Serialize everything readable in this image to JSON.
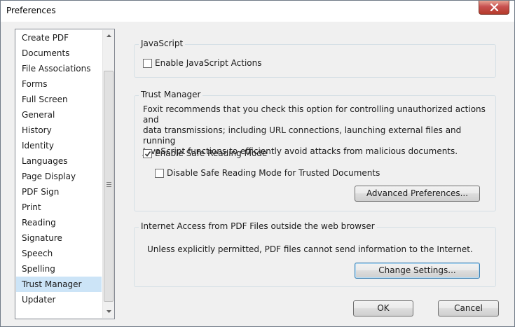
{
  "window": {
    "title": "Preferences"
  },
  "sidebar": {
    "items": [
      {
        "label": "Create PDF"
      },
      {
        "label": "Documents"
      },
      {
        "label": "File Associations"
      },
      {
        "label": "Forms"
      },
      {
        "label": "Full Screen"
      },
      {
        "label": "General"
      },
      {
        "label": "History"
      },
      {
        "label": "Identity"
      },
      {
        "label": "Languages"
      },
      {
        "label": "Page Display"
      },
      {
        "label": "PDF Sign"
      },
      {
        "label": "Print"
      },
      {
        "label": "Reading"
      },
      {
        "label": "Signature"
      },
      {
        "label": "Speech"
      },
      {
        "label": "Spelling"
      },
      {
        "label": "Trust Manager"
      },
      {
        "label": "Updater"
      }
    ],
    "selected": "Trust Manager"
  },
  "javascript_group": {
    "title": "JavaScript",
    "enable_actions": {
      "label": "Enable JavaScript Actions",
      "checked": false
    }
  },
  "trust_group": {
    "title": "Trust Manager",
    "description_lines": [
      "Foxit recommends that you check this option for controlling unauthorized actions and",
      "data transmissions; including URL connections, launching external files and running",
      "JavaScript functions to efficiently avoid attacks from malicious documents."
    ],
    "safe_reading": {
      "label": "Enable Safe Reading Mode",
      "checked": true
    },
    "disable_trusted": {
      "label": "Disable Safe Reading Mode for Trusted Documents",
      "checked": false
    },
    "advanced_button": "Advanced Preferences..."
  },
  "internet_group": {
    "title": "Internet Access from PDF Files outside the web browser",
    "message": "Unless explicitly permitted, PDF files cannot send information to the Internet.",
    "change_button": "Change Settings..."
  },
  "footer": {
    "ok_label": "OK",
    "cancel_label": "Cancel"
  },
  "icons": {
    "close": "close-icon",
    "scroll_up": "scroll-up-arrow-icon",
    "scroll_down": "scroll-down-arrow-icon",
    "check": "checkmark-icon"
  }
}
